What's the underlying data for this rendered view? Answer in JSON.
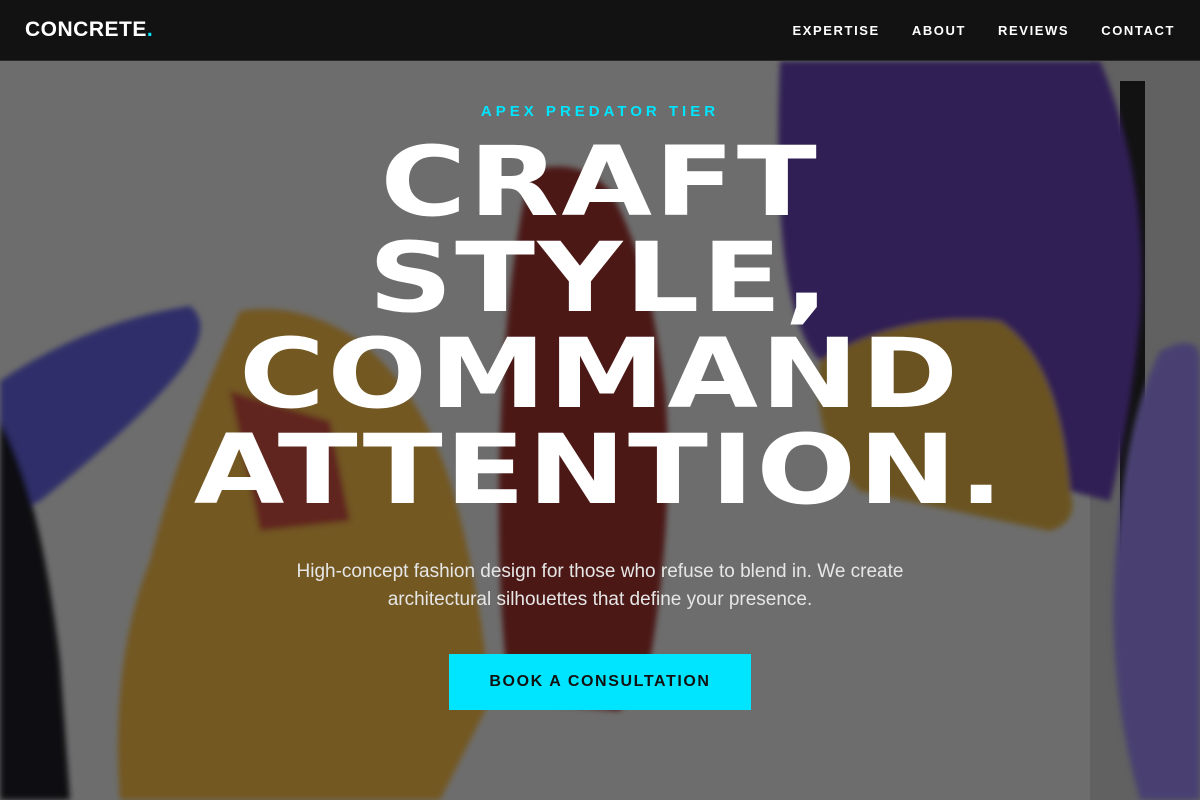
{
  "brand": {
    "name": "CONCRETE",
    "dot": "."
  },
  "nav": {
    "links": [
      "EXPERTISE",
      "ABOUT",
      "REVIEWS",
      "CONTACT"
    ]
  },
  "hero": {
    "eyebrow": "APEX PREDATOR TIER",
    "headline": [
      "CRAFT",
      "STYLE,",
      "COMMAND",
      "ATTENTION."
    ],
    "subtitle": "High-concept fashion design for those who refuse to blend in. We create architectural silhouettes that define your presence.",
    "cta_label": "BOOK A CONSULTATION",
    "background": "photo of colorful nylon garments hanging in a white gallery"
  },
  "colors": {
    "accent": "#00e5ff",
    "nav_bg": "#121212",
    "text": "#ffffff"
  }
}
